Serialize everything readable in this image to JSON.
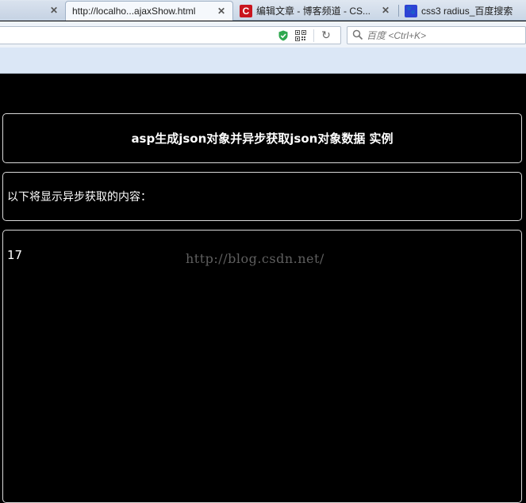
{
  "browser": {
    "tabs": [
      {
        "label": "",
        "active": false
      },
      {
        "label": "http://localho...ajaxShow.html",
        "active": true
      },
      {
        "label": "编辑文章 - 博客频道 - CS...",
        "active": false,
        "favicon": "csdn-icon",
        "favicon_glyph": "C"
      },
      {
        "label": "css3 radius_百度搜索",
        "active": false,
        "favicon": "baidu-paw-icon",
        "favicon_glyph": "🐾"
      }
    ],
    "close_glyph": "✕",
    "reload_glyph": "↻",
    "search_placeholder": "百度 <Ctrl+K>",
    "colors": {
      "accent_shield": "#2fa84f",
      "csdn_red": "#c9151e",
      "baidu_blue": "#2d42d4"
    }
  },
  "page": {
    "title": "asp生成json对象并异步获取json对象数据 实例",
    "intro": "以下将显示异步获取的内容：",
    "content": "17",
    "watermark": "http://blog.csdn.net/"
  }
}
